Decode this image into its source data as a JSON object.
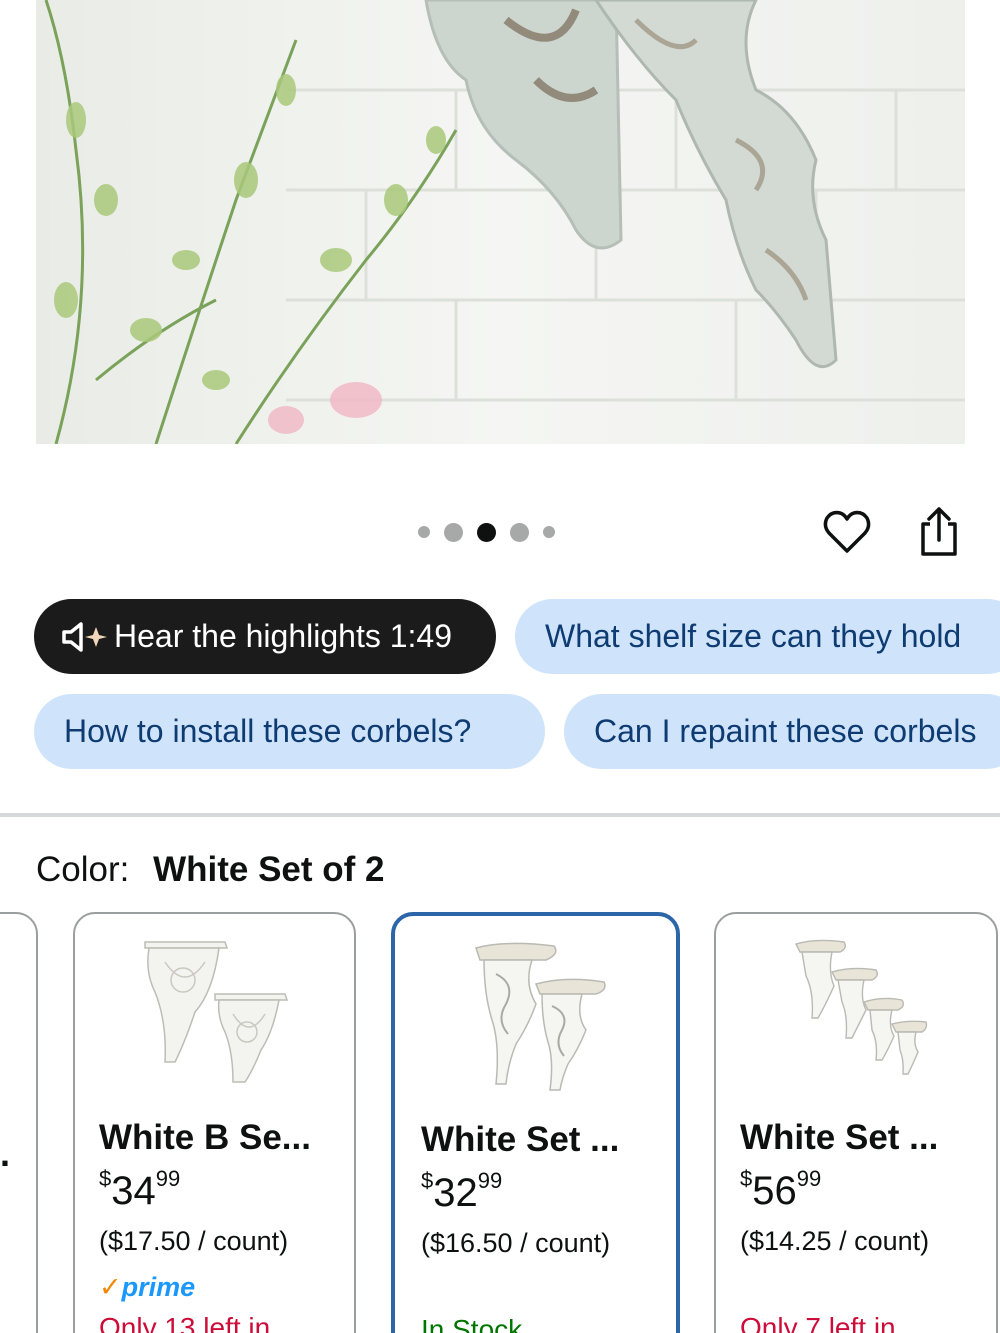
{
  "gallery": {
    "image_alt_icon": "corbel-product-photo",
    "dots": [
      {
        "size": "small",
        "active": false
      },
      {
        "size": "medium",
        "active": false
      },
      {
        "size": "medium",
        "active": true
      },
      {
        "size": "medium",
        "active": false
      },
      {
        "size": "small",
        "active": false
      }
    ],
    "active_index": 3,
    "total": 5
  },
  "actions": {
    "wishlist_icon": "heart-icon",
    "share_icon": "share-icon"
  },
  "chips": {
    "highlights_label": "Hear the highlights 1:49",
    "highlights_icon": "speaker-sparkle-icon",
    "shelf_size": "What shelf size can they hold",
    "install": "How to install these corbels?",
    "repaint": "Can I repaint these corbels"
  },
  "color": {
    "label": "Color:",
    "selected": "White Set of 2"
  },
  "variants": [
    {
      "title": "White B Se...",
      "price_symbol": "$",
      "price_whole": "34",
      "price_fraction": "99",
      "unit_price": "($17.50 / count)",
      "prime": "prime",
      "stock": "Only 13 left in",
      "stock_status": "low",
      "selected": false
    },
    {
      "title": "White Set ...",
      "price_symbol": "$",
      "price_whole": "32",
      "price_fraction": "99",
      "unit_price": "($16.50 / count)",
      "stock": "In Stock",
      "stock_status": "in",
      "selected": true
    },
    {
      "title": "White Set ...",
      "price_symbol": "$",
      "price_whole": "56",
      "price_fraction": "99",
      "unit_price": "($14.25 / count)",
      "stock": "Only 7 left in",
      "stock_status": "low",
      "selected": false
    }
  ],
  "colors": {
    "selected_border": "#2c65a8",
    "chip_blue": "#cfe4fb",
    "chip_text": "#0e3b72",
    "low_stock": "#cc0c39",
    "in_stock": "#007600",
    "prime_blue": "#1a98ff",
    "prime_check": "#f08804"
  }
}
